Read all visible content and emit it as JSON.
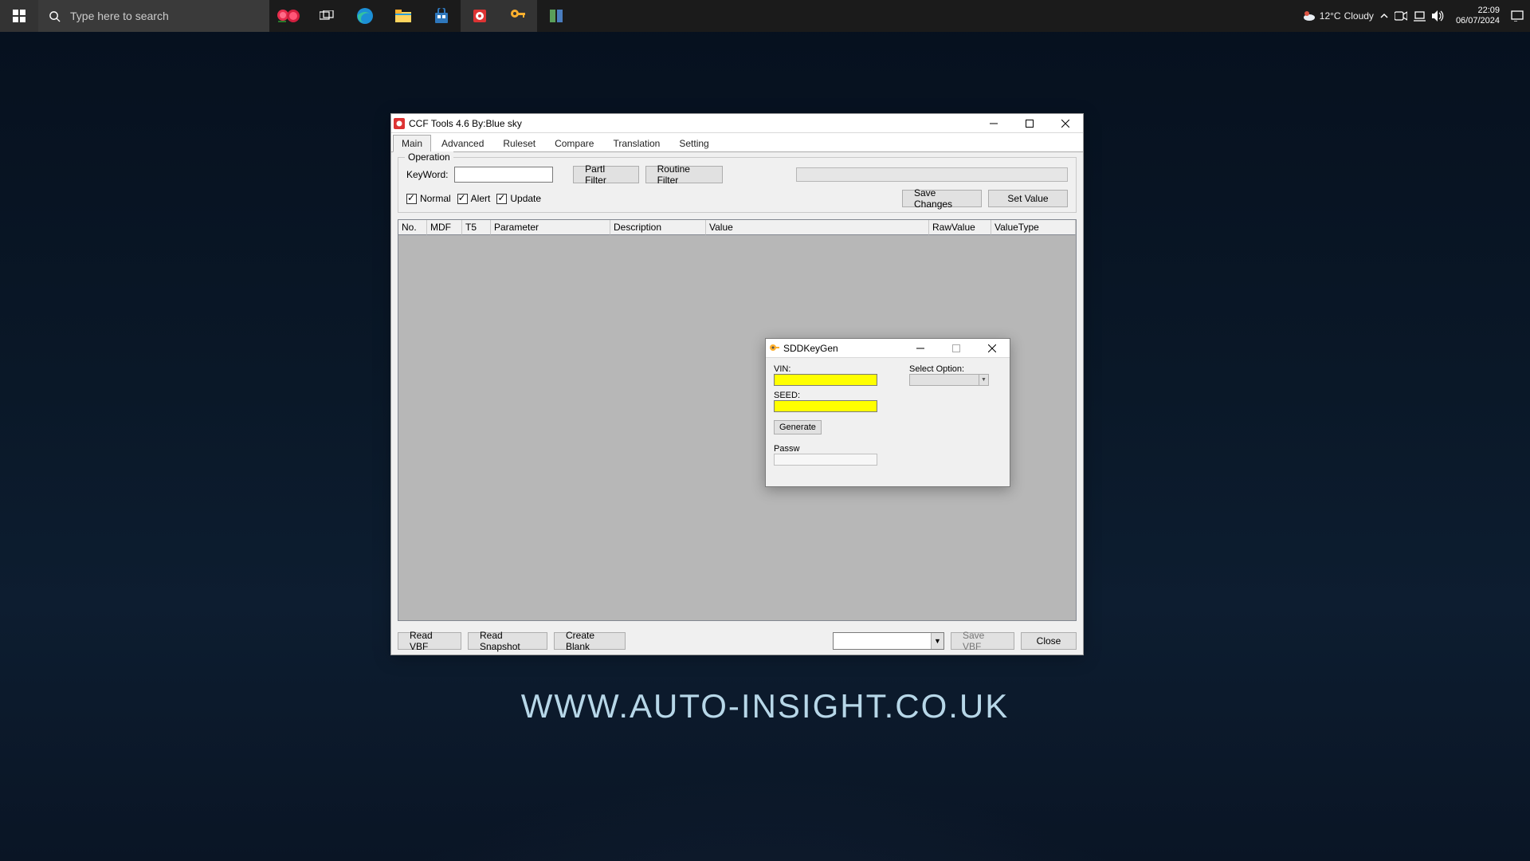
{
  "taskbar": {
    "search_placeholder": "Type here to search",
    "weather": {
      "temp": "12°C",
      "cond": "Cloudy"
    },
    "time": "22:09",
    "date": "06/07/2024"
  },
  "ccf": {
    "title": "CCF Tools 4.6   By:Blue sky",
    "tabs": [
      "Main",
      "Advanced",
      "Ruleset",
      "Compare",
      "Translation",
      "Setting"
    ],
    "legend": "Operation",
    "keyword_lbl": "KeyWord:",
    "btn_parti": "PartI Filter",
    "btn_routine": "Routine Filter",
    "chk_normal": "Normal",
    "chk_alert": "Alert",
    "chk_update": "Update",
    "btn_save_changes": "Save Changes",
    "btn_set_value": "Set Value",
    "columns": [
      "No.",
      "MDF",
      "T5",
      "Parameter",
      "Description",
      "Value",
      "RawValue",
      "ValueType"
    ],
    "btn_read_vbf": "Read VBF",
    "btn_read_snapshot": "Read Snapshot",
    "btn_create_blank": "Create Blank",
    "btn_save_vbf": "Save VBF",
    "btn_close": "Close"
  },
  "key": {
    "title": "SDDKeyGen",
    "lbl_vin": "VIN:",
    "lbl_seed": "SEED:",
    "lbl_select": "Select Option:",
    "btn_generate": "Generate",
    "lbl_passw": "Passw"
  },
  "watermark": "WWW.AUTO-INSIGHT.CO.UK"
}
